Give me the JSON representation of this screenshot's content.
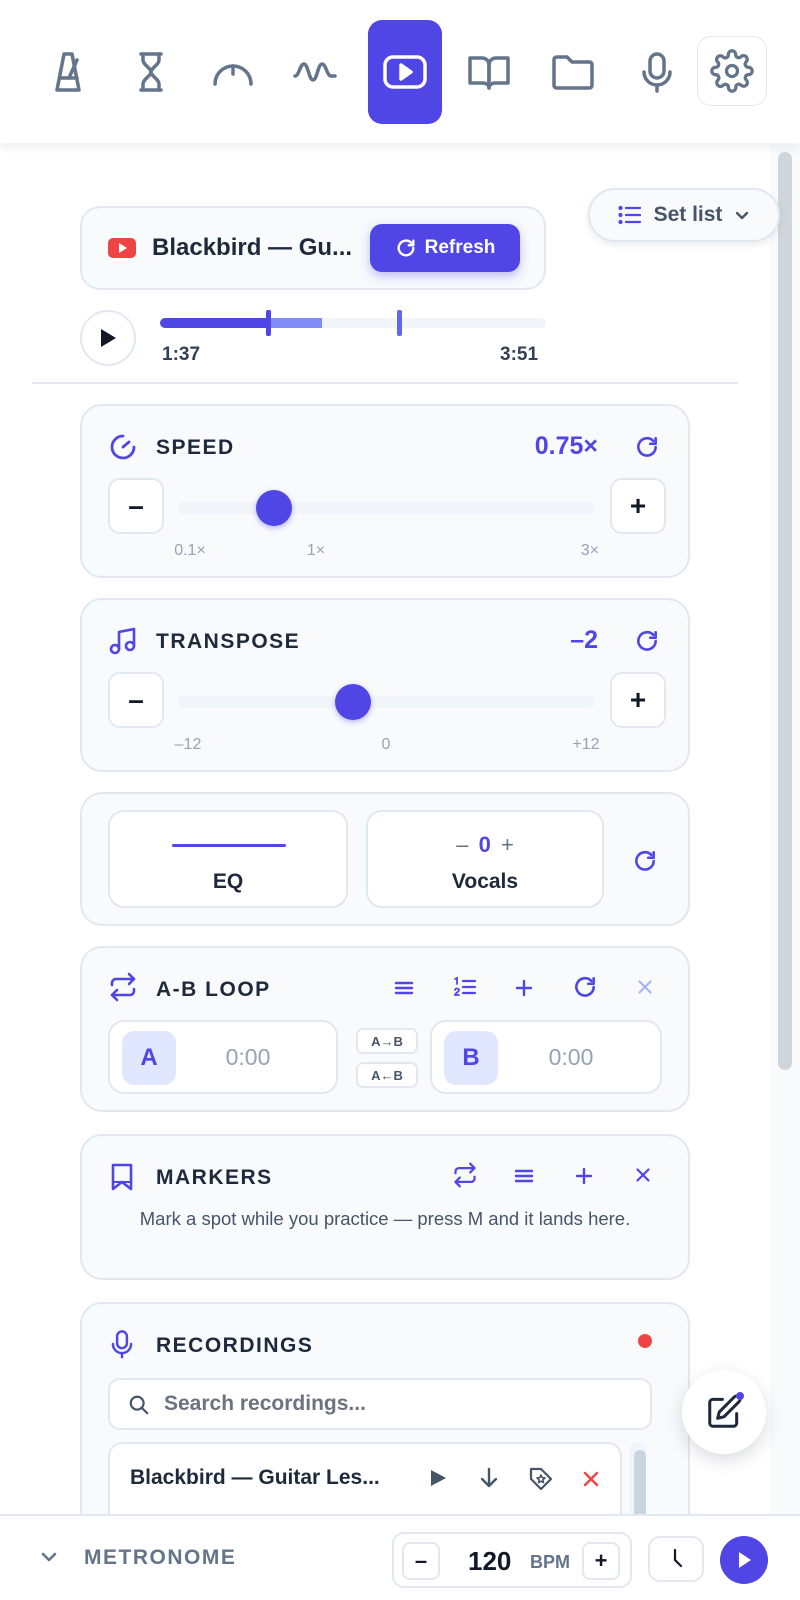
{
  "nav": {
    "items": [
      {
        "icon": "metronome-icon"
      },
      {
        "icon": "hourglass-icon"
      },
      {
        "icon": "tuner-gauge-icon"
      },
      {
        "icon": "waveform-icon"
      },
      {
        "icon": "youtube-player-icon",
        "active": true
      },
      {
        "icon": "book-icon"
      },
      {
        "icon": "folder-icon"
      },
      {
        "icon": "microphone-icon"
      },
      {
        "icon": "gear-icon"
      }
    ]
  },
  "video": {
    "title": "Blackbird — Gu...",
    "refresh_label": "Refresh",
    "current_time": "1:37",
    "duration": "3:51",
    "progress_fraction": 0.42,
    "loop_start_fraction": 0.28,
    "loop_end_fraction": 0.62
  },
  "setlist": {
    "label": "Set list"
  },
  "speed": {
    "title": "SPEED",
    "value": "0.75×",
    "minus": "–",
    "plus": "+",
    "ticks": [
      "0.1×",
      "1×",
      "3×"
    ],
    "slider_fraction": 0.23
  },
  "transpose": {
    "title": "TRANSPOSE",
    "value": "–2",
    "minus": "–",
    "plus": "+",
    "ticks": [
      "–12",
      "0",
      "+12"
    ],
    "slider_fraction": 0.42
  },
  "mix": {
    "eq_label": "EQ",
    "vocals_label": "Vocals",
    "vocals_minus": "–",
    "vocals_value": "0",
    "vocals_plus": "+"
  },
  "ab_loop": {
    "title": "A-B LOOP",
    "a_label": "A",
    "a_time": "0:00",
    "b_label": "B",
    "b_time": "0:00",
    "swap_ab": "A→B",
    "swap_ba": "A←B"
  },
  "markers": {
    "title": "MARKERS",
    "empty_text": "Mark a spot while you practice — press M and it lands here."
  },
  "recordings": {
    "title": "RECORDINGS",
    "search_placeholder": "Search recordings...",
    "items": [
      {
        "title": "Blackbird — Guitar Les..."
      }
    ]
  },
  "metronome": {
    "label": "METRONOME",
    "bpm": "120",
    "bpm_unit": "BPM",
    "minus": "–",
    "plus": "+"
  },
  "colors": {
    "accent": "#4f46e5",
    "record": "#ef4444",
    "youtube": "#ef4444"
  }
}
